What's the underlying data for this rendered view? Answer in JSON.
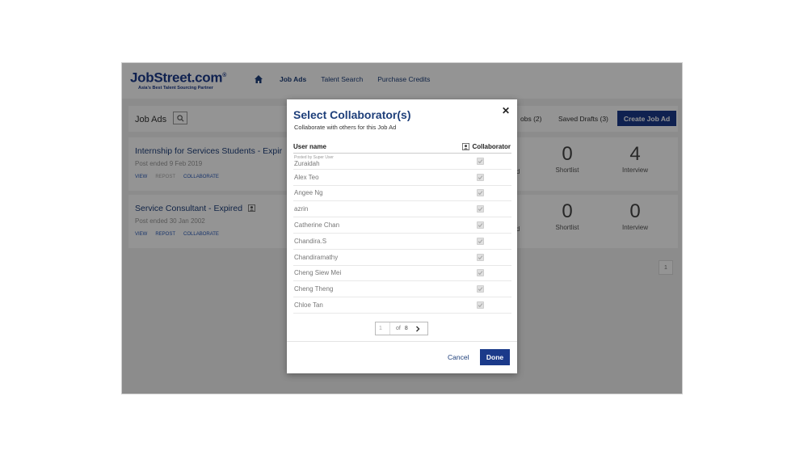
{
  "header": {
    "logo_text": "JobStreet.com",
    "logo_reg": "®",
    "tagline": "Asia's Best Talent Sourcing Partner",
    "nav": [
      "Job Ads",
      "Talent Search",
      "Purchase Credits"
    ]
  },
  "toolbar": {
    "title": "Job Ads",
    "jobs_tab": "obs (2)",
    "drafts_tab": "Saved Drafts (3)",
    "create_label": "Create Job Ad"
  },
  "jobs": [
    {
      "title": "Internship for Services Students - Expir",
      "date": "Post ended 9 Feb 2019",
      "actions": [
        "VIEW",
        "REPOST",
        "COLLABORATE"
      ],
      "shortlist": "0",
      "interview": "4"
    },
    {
      "title": "Service Consultant - Expired",
      "date": "Post ended 30 Jan 2002",
      "actions": [
        "VIEW",
        "REPOST",
        "COLLABORATE"
      ],
      "shortlist": "0",
      "interview": "0"
    }
  ],
  "stats_labels": {
    "shortlist": "Shortlist",
    "interview": "Interview",
    "frag": "d"
  },
  "bg_pager": "1",
  "modal": {
    "title": "Select Collaborator(s)",
    "subtitle": "Collaborate with others for this Job Ad",
    "col_user": "User name",
    "col_collab": "Collaborator",
    "posted_by": "Posted by Super User",
    "users": [
      "Zuraidah",
      "Alex Teo",
      "Angee Ng",
      "azrin",
      "Catherine Chan",
      "Chandira.S",
      "Chandiramathy",
      "Cheng Siew Mei",
      "Cheng Theng",
      "Chloe Tan"
    ],
    "pager": {
      "page": "1",
      "of": "of",
      "total": "8"
    },
    "cancel": "Cancel",
    "done": "Done"
  },
  "colors": {
    "primary": "#1b3a8a",
    "link": "#1e3f7a"
  }
}
